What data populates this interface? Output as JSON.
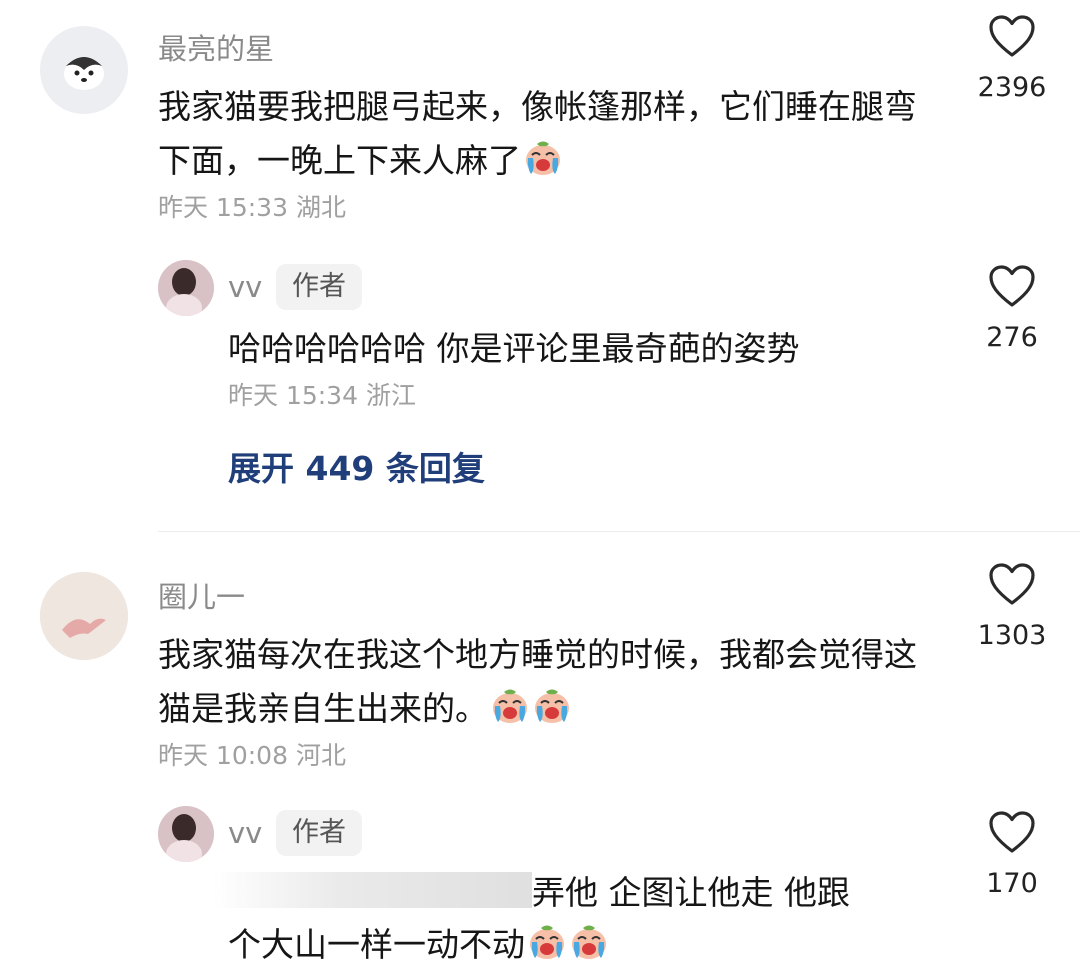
{
  "comments": [
    {
      "user": "最亮的星",
      "text": "我家猫要我把腿弓起来，像帐篷那样，它们睡在腿弯下面，一晚上下来人麻了",
      "emoji": "crying-face-emoji",
      "time": "昨天 15:33 湖北",
      "likes": "2396",
      "reply": {
        "user": "vv",
        "badge": "作者",
        "text": "哈哈哈哈哈哈 你是评论里最奇葩的姿势",
        "time": "昨天 15:34 浙江",
        "likes": "276"
      },
      "expand_label": "展开 449 条回复"
    },
    {
      "user": "圈儿一",
      "text": "我家猫每次在我这个地方睡觉的时候，我都会觉得这猫是我亲自生出来的。",
      "emoji": "crying-face-emoji",
      "time": "昨天 10:08 河北",
      "likes": "1303",
      "reply": {
        "user": "vv",
        "badge": "作者",
        "text_line1": "弄他 企图让他走 他跟",
        "text_line2": "个大山一样一动不动",
        "likes": "170"
      }
    }
  ],
  "colors": {
    "link": "#1f3e7a",
    "meta": "#a0a0a0",
    "name": "#8a8a8a"
  }
}
